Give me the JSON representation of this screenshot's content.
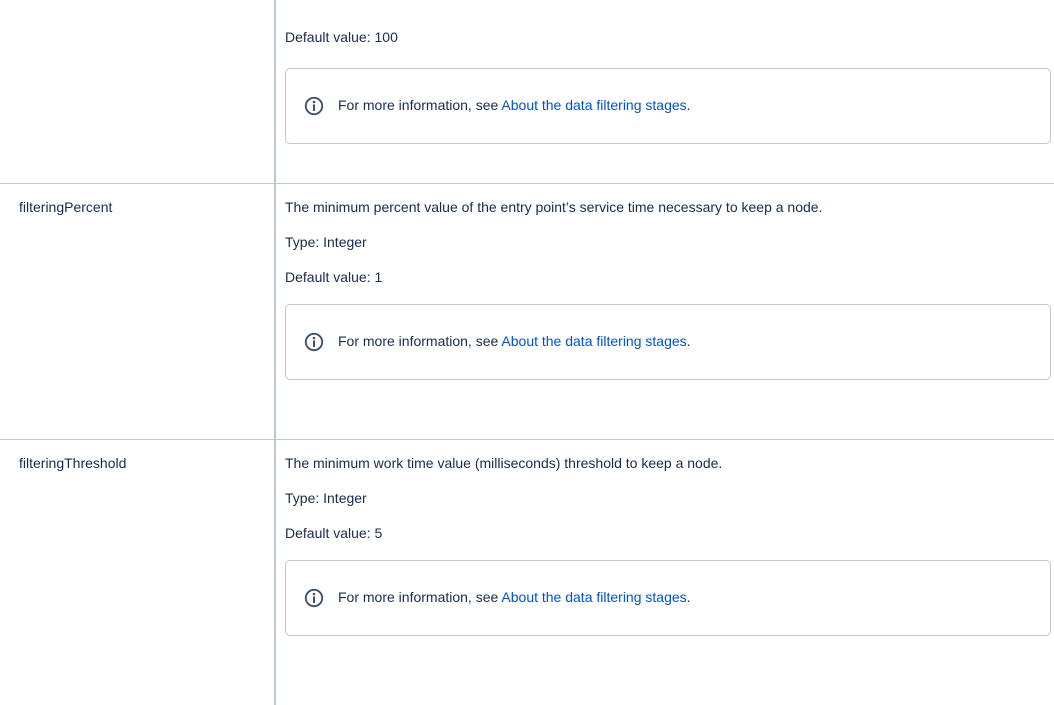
{
  "rows": [
    {
      "name": "",
      "lines": [
        "Default value: 100"
      ],
      "info": {
        "prefix": "For more information, see ",
        "link_text": "About the data filtering stages",
        "suffix": "."
      }
    },
    {
      "name": "filteringPercent",
      "lines": [
        "The minimum percent value of the entry point’s service time necessary to keep a node.",
        "Type: Integer",
        "Default value: 1"
      ],
      "info": {
        "prefix": "For more information, see ",
        "link_text": "About the data filtering stages",
        "suffix": "."
      }
    },
    {
      "name": "filteringThreshold",
      "lines": [
        "The minimum work time value (milliseconds) threshold to keep a node.",
        "Type: Integer",
        "Default value: 5"
      ],
      "info": {
        "prefix": "For more information, see ",
        "link_text": "About the data filtering stages",
        "suffix": "."
      }
    }
  ],
  "colors": {
    "text": "#172b4d",
    "link": "#0052cc",
    "border": "#c1c7d0",
    "icon": "#42526e"
  },
  "icons": {
    "info_panel": "info-circle-icon"
  }
}
